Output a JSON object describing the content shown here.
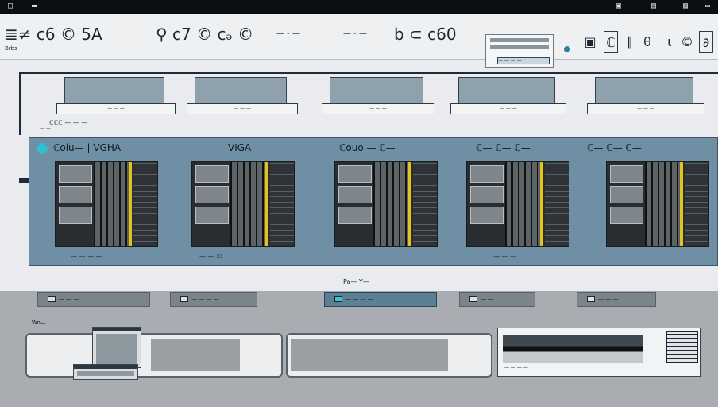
{
  "titlebar": {
    "left_icons": [
      "file-icon",
      "menu-icon"
    ],
    "right_icons": [
      "camera-icon",
      "document-icon",
      "book-icon",
      "window-icon"
    ]
  },
  "toolbar": {
    "glyph_left": "≣≠ c6 © 5A",
    "group_text_1": "— ‑ —",
    "glyph_mid": "⚲ c7 © cₔ ©",
    "group_text_2": "— ‑ —",
    "glyph_right": "b ⊂ c60",
    "small_label": "Brbs",
    "panel_selected": "— — — —",
    "right_tools": [
      "▣",
      "ℂ",
      "∥",
      "θ",
      "ι",
      "©",
      "∂"
    ],
    "accent": "#2a7fa0"
  },
  "strip": {
    "thumbs": [
      {
        "caption": "— — —"
      },
      {
        "caption": "— — —"
      },
      {
        "caption": "— — —"
      },
      {
        "caption": "— — —"
      },
      {
        "caption": "— — —"
      }
    ],
    "note": "ℂℂℂ — — —",
    "note2": "— —"
  },
  "gallery": {
    "titles": [
      "ℂoiu— | VGHA",
      "VIGA",
      "ℂouo — ℂ—",
      "ℂ— ℂ— ℂ—",
      "ℂ— ℂ— ℂ—"
    ],
    "captions": [
      "— — — —",
      "— — ©",
      "",
      "— — —",
      ""
    ],
    "bg_color": "#6f90a4",
    "highlight_color": "#e5c41a"
  },
  "mid_label": "Pa— Y—",
  "tabs": [
    {
      "label": "— — —"
    },
    {
      "label": "— — — —"
    },
    {
      "label": "— — — —"
    },
    {
      "label": "— —"
    },
    {
      "label": "— — —"
    }
  ],
  "section_label": "Wo—",
  "card": {
    "caption": "— — — —",
    "label": "— — —"
  }
}
